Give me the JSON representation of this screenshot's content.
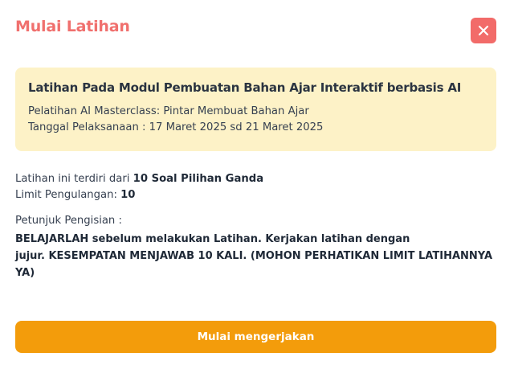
{
  "modal": {
    "title": "Mulai Latihan",
    "close_icon": "close-icon"
  },
  "info": {
    "module_title": "Latihan Pada Modul Pembuatan Bahan Ajar Interaktif berbasis AI",
    "training": "Pelatihan AI Masterclass: Pintar Membuat Bahan Ajar",
    "date": "Tanggal Pelaksanaan : 17 Maret 2025 sd 21 Maret 2025"
  },
  "details": {
    "consists_prefix": "Latihan ini terdiri dari ",
    "consists_value": "10 Soal Pilihan Ganda",
    "limit_prefix": "Limit Pengulangan: ",
    "limit_value": "10",
    "instructions_label": "Petunjuk Pengisian :",
    "instructions_line1": "BELAJARLAH sebelum melakukan Latihan. Kerjakan latihan dengan",
    "instructions_line2": "jujur. KESEMPATAN MENJAWAB 10 KALI. (MOHON PERHATIKAN LIMIT LATIHANNYA",
    "instructions_line3": "YA)"
  },
  "actions": {
    "start_label": "Mulai mengerjakan"
  },
  "colors": {
    "title": "#f0706e",
    "close_bg": "#f26b69",
    "info_bg": "#fdf2c7",
    "start_bg": "#f39c0b"
  }
}
